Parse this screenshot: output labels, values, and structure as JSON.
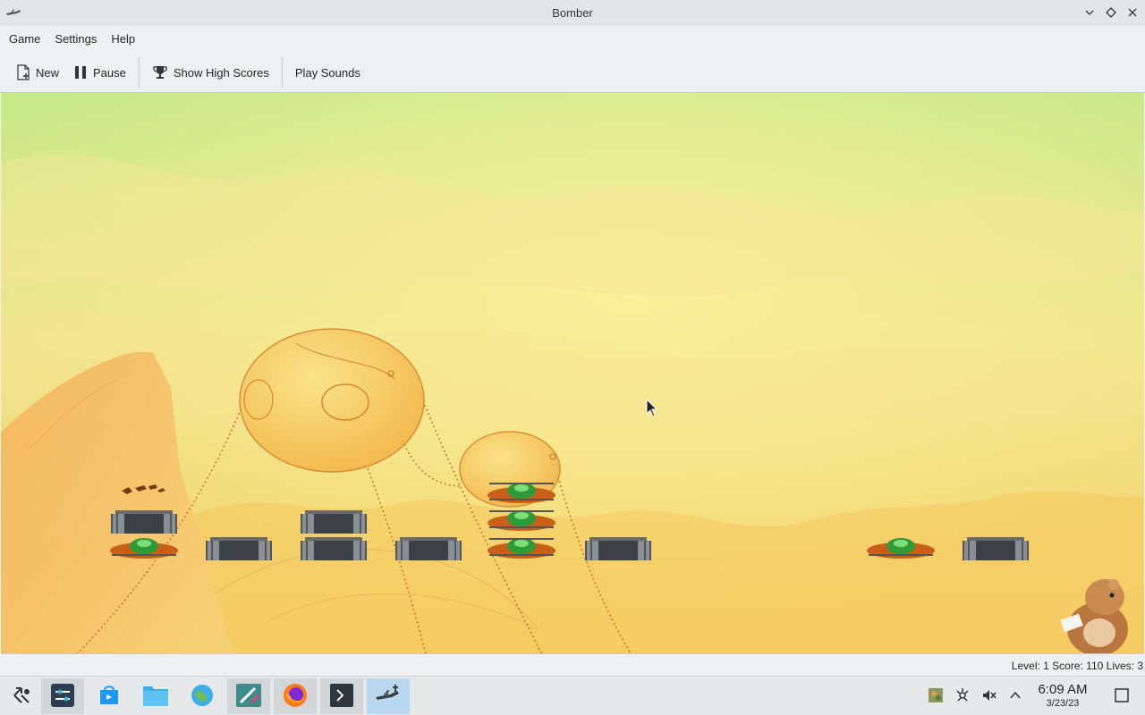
{
  "window": {
    "title": "Bomber",
    "app_icon": "bomber-plane-icon",
    "controls": [
      "minimize-chevron",
      "maximize-diamond",
      "close-x"
    ]
  },
  "menubar": {
    "items": [
      "Game",
      "Settings",
      "Help"
    ]
  },
  "toolbar": {
    "new_label": "New",
    "pause_label": "Pause",
    "high_scores_label": "Show High Scores",
    "sounds_label": "Play Sounds"
  },
  "game": {
    "background_colors": [
      "#c9e889",
      "#f2e488",
      "#f3c96a"
    ],
    "scene_elements": [
      "hot-air-balloon",
      "hot-air-balloon",
      "building-blocks",
      "flying-saucer-roofs",
      "hamster-mascot",
      "mouse-cursor"
    ]
  },
  "statusbar": {
    "text": "Level: 1  Score: 110  Lives: 3"
  },
  "taskbar": {
    "apps": [
      "application-launcher-icon",
      "settings-icon",
      "discover-store-icon",
      "file-manager-icon",
      "web-browser-icon",
      "kate-editor-icon",
      "firefox-icon",
      "terminal-icon",
      "bomber-icon"
    ],
    "tray": [
      "game-tray-icon",
      "network-icon",
      "volume-muted-icon",
      "expand-tray-icon"
    ],
    "time": "6:09 AM",
    "date": "3/23/23",
    "show_desktop": "show-desktop-icon"
  }
}
